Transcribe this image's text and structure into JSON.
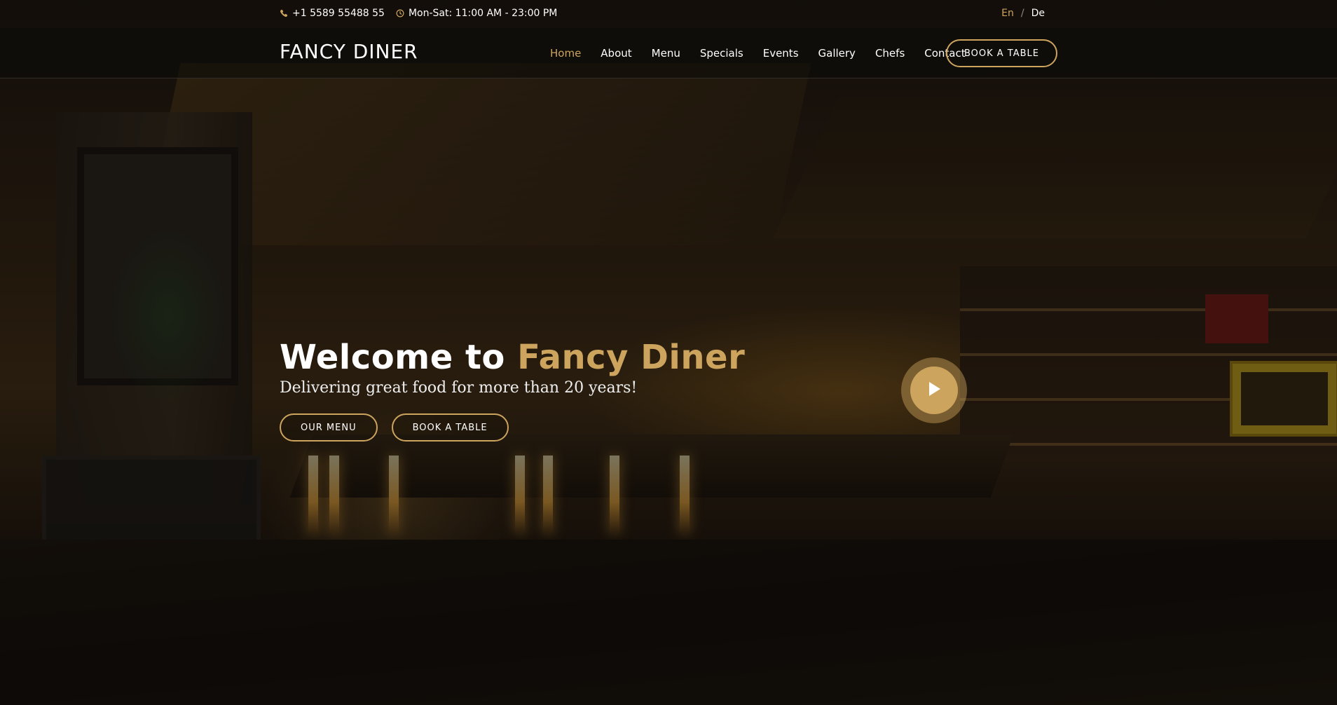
{
  "topbar": {
    "phone": "+1 5589 55488 55",
    "hours": "Mon-Sat: 11:00 AM - 23:00 PM",
    "phone_icon": "phone-icon",
    "clock_icon": "clock-icon",
    "languages": {
      "active": "En",
      "separator": "/",
      "other": "De"
    }
  },
  "header": {
    "logo": "FANCY DINER",
    "nav": {
      "home": "Home",
      "about": "About",
      "menu": "Menu",
      "specials": "Specials",
      "events": "Events",
      "gallery": "Gallery",
      "chefs": "Chefs",
      "contact": "Contact"
    },
    "active_nav": "Home",
    "book_button": "BOOK A TABLE"
  },
  "hero": {
    "title_prefix": "Welcome to ",
    "title_accent": "Fancy Diner",
    "subtitle": "Delivering great food for more than 20 years!",
    "menu_button": "OUR MENU",
    "book_button": "BOOK A TABLE",
    "play_icon": "play-icon"
  },
  "colors": {
    "accent": "#cda45e",
    "text": "#ffffff",
    "header_bg": "#0c0b09"
  }
}
